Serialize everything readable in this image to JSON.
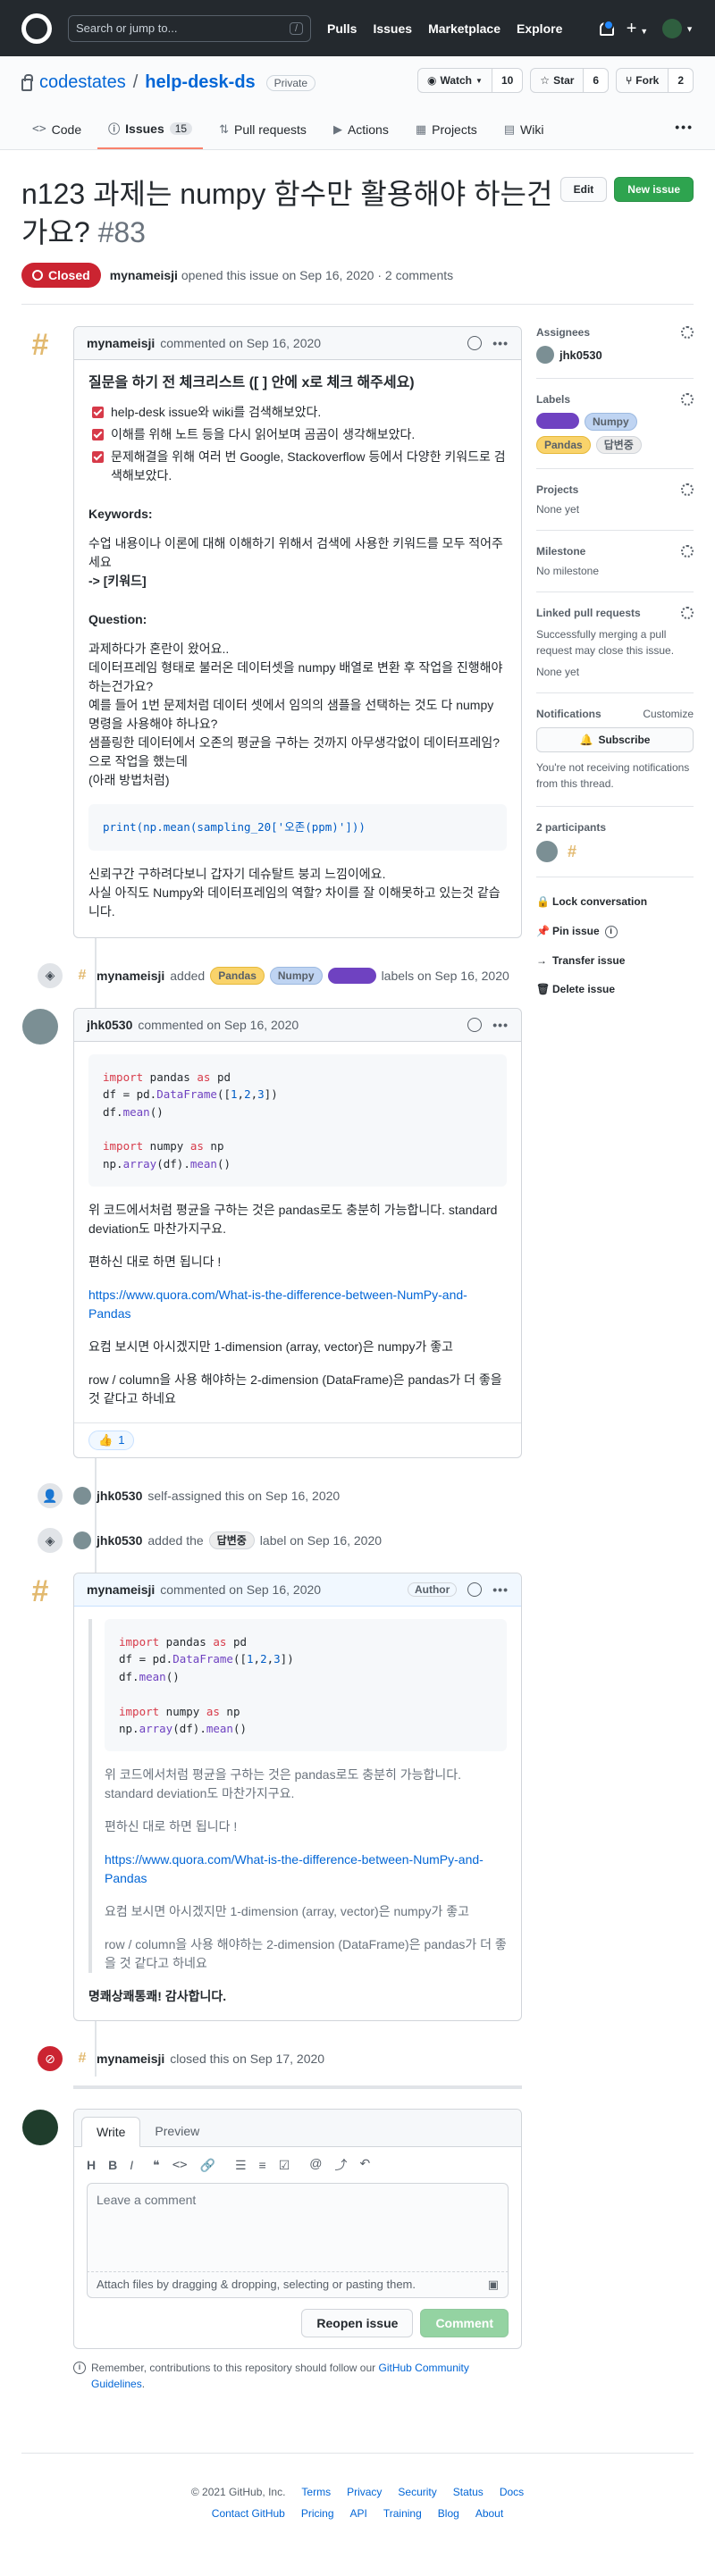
{
  "header": {
    "search_placeholder": "Search or jump to...",
    "slash": "/",
    "nav": [
      "Pulls",
      "Issues",
      "Marketplace",
      "Explore"
    ]
  },
  "repo": {
    "owner": "codestates",
    "sep": "/",
    "name": "help-desk-ds",
    "visibility": "Private",
    "watch_label": "Watch",
    "watch_count": "10",
    "star_label": "Star",
    "star_count": "6",
    "fork_label": "Fork",
    "fork_count": "2",
    "tabs": [
      {
        "label": "Code",
        "icon": "<>"
      },
      {
        "label": "Issues",
        "icon": "ⓘ",
        "count": "15"
      },
      {
        "label": "Pull requests",
        "icon": "⇅"
      },
      {
        "label": "Actions",
        "icon": "▶"
      },
      {
        "label": "Projects",
        "icon": "▦"
      },
      {
        "label": "Wiki",
        "icon": "▤"
      }
    ],
    "more": "•••"
  },
  "issue": {
    "title": "n123 과제는 numpy 함수만 활용해야 하는건가요?",
    "number": "#83",
    "edit_label": "Edit",
    "new_issue_label": "New issue",
    "status": "Closed",
    "author": "mynameisji",
    "meta": "opened this issue on Sep 16, 2020 · 2 comments"
  },
  "comment1": {
    "author": "mynameisji",
    "date": "commented on Sep 16, 2020",
    "heading": "질문을 하기 전 체크리스트 ([ ] 안에 x로 체크 해주세요)",
    "checks": [
      "help-desk issue와 wiki를 검색해보았다.",
      "이해를 위해 노트 등을 다시 읽어보며 곰곰이 생각해보았다.",
      "문제해결을 위해 여러 번 Google, Stackoverflow 등에서 다양한 키워드로 검색해보았다."
    ],
    "keywords_title": "Keywords:",
    "keywords_text": "수업 내용이나 이론에 대해 이해하기 위해서 검색에 사용한 키워드를 모두 적어주세요",
    "keywords_arrow": "-> [키워드]",
    "question_title": "Question:",
    "question_lines": [
      "과제하다가 혼란이 왔어요..",
      "데이터프레임 형태로 불러온 데이터셋을 numpy 배열로 변환 후 작업을 진행해야 하는건가요?",
      "예를 들어 1번 문제처럼 데이터 셋에서 임의의 샘플을 선택하는 것도 다 numpy 명령을 사용해야 하나요?",
      "샘플링한 데이터에서 오존의 평균을 구하는 것까지 아무생각없이 데이터프레임?으로 작업을 했는데",
      "(아래 방법처럼)"
    ],
    "code": "print(np.mean(sampling_20['오존(ppm)']))",
    "closing_lines": [
      "신뢰구간 구하려다보니 갑자기 데슈탈트 붕괴 느낌이에요.",
      "사실 아직도 Numpy와 데이터프레임의 역할? 차이를 잘 이해못하고 있는것 같습니다."
    ]
  },
  "event_labels": {
    "actor": "mynameisji",
    "verb": "added",
    "labels": [
      "Pandas",
      "Numpy",
      ""
    ],
    "suffix": "labels on Sep 16, 2020"
  },
  "comment2": {
    "author": "jhk0530",
    "date": "commented on Sep 16, 2020",
    "code_lines": [
      "import pandas as pd",
      "df = pd.DataFrame([1,2,3])",
      "df.mean()",
      "",
      "import numpy as np",
      "np.array(df).mean()"
    ],
    "p1": "위 코드에서처럼 평균을 구하는 것은 pandas로도 충분히 가능합니다. standard deviation도 마찬가지구요.",
    "p2": "편하신 대로 하면 됩니다 !",
    "link": "https://www.quora.com/What-is-the-difference-between-NumPy-and-Pandas",
    "p3": "요컴 보시면 아시겠지만 1-dimension (array, vector)은 numpy가 좋고",
    "p4": "row / column을 사용 해야하는 2-dimension (DataFrame)은 pandas가 더 좋을 것 같다고 하네요",
    "reaction_emoji": "👍",
    "reaction_count": "1"
  },
  "event_assign": {
    "actor": "jhk0530",
    "text": "self-assigned this on Sep 16, 2020"
  },
  "event_label2": {
    "actor": "jhk0530",
    "pre": "added the",
    "label": "답변중",
    "post": "label on Sep 16, 2020"
  },
  "comment3": {
    "author": "mynameisji",
    "date": "commented on Sep 16, 2020",
    "badge": "Author",
    "p1": "위 코드에서처럼 평균을 구하는 것은 pandas로도 충분히 가능합니다. standard deviation도 마찬가지구요.",
    "p2": "편하신 대로 하면 됩니다 !",
    "link": "https://www.quora.com/What-is-the-difference-between-NumPy-and-Pandas",
    "p3": "요컴 보시면 아시겠지만 1-dimension (array, vector)은 numpy가 좋고",
    "p4": "row / column을 사용 해야하는 2-dimension (DataFrame)은 pandas가 더 좋을 것 같다고 하네요",
    "thanks": "명쾌상쾌통쾌! 감사합니다."
  },
  "event_closed": {
    "actor": "mynameisji",
    "text": "closed this on Sep 17, 2020"
  },
  "editor": {
    "tab_write": "Write",
    "tab_preview": "Preview",
    "placeholder": "Leave a comment",
    "attach": "Attach files by dragging & dropping, selecting or pasting them.",
    "reopen": "Reopen issue",
    "comment": "Comment",
    "remember_pre": "Remember, contributions to this repository should follow our",
    "remember_link": "GitHub Community Guidelines",
    "remember_post": "."
  },
  "sidebar": {
    "assignees_title": "Assignees",
    "assignee": "jhk0530",
    "labels_title": "Labels",
    "labels": [
      {
        "name": "",
        "bg": "#6f42c1",
        "fg": "#ffffff"
      },
      {
        "name": "Numpy",
        "bg": "#bfd4f2",
        "fg": "#24292e"
      },
      {
        "name": "Pandas",
        "bg": "#f9d36b",
        "fg": "#24292e"
      },
      {
        "name": "답변중",
        "bg": "#ededed",
        "fg": "#24292e"
      }
    ],
    "projects_title": "Projects",
    "projects_value": "None yet",
    "milestone_title": "Milestone",
    "milestone_value": "No milestone",
    "linked_title": "Linked pull requests",
    "linked_desc": "Successfully merging a pull request may close this issue.",
    "linked_value": "None yet",
    "notif_title": "Notifications",
    "notif_customize": "Customize",
    "subscribe": "Subscribe",
    "notif_desc": "You're not receiving notifications from this thread.",
    "participants_title": "2 participants",
    "actions": [
      "Lock conversation",
      "Pin issue",
      "Transfer issue",
      "Delete issue"
    ]
  },
  "footer": {
    "copyright": "© 2021 GitHub, Inc.",
    "row1": [
      "Terms",
      "Privacy",
      "Security",
      "Status",
      "Docs"
    ],
    "row2": [
      "Contact GitHub",
      "Pricing",
      "API",
      "Training",
      "Blog",
      "About"
    ]
  },
  "colors": {
    "closed": "#cb2431",
    "green": "#2ea44f",
    "label_pandas": "#f9d36b",
    "label_numpy": "#bfd4f2",
    "label_purple": "#6f42c1",
    "label_answering": "#ededed"
  }
}
